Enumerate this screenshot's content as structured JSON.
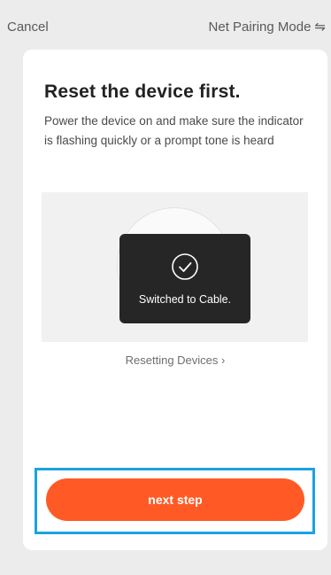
{
  "header": {
    "cancel_label": "Cancel",
    "mode_label": "Net Pairing Mode",
    "mode_icon": "⇋",
    "mode_icon_name": "swap-icon"
  },
  "card": {
    "title": "Reset the device first.",
    "description": "Power the device on and make sure the indicator is flashing quickly or a prompt tone is heard",
    "toast_text": "Switched to Cable.",
    "reset_link": "Resetting Devices ›",
    "next_label": "next step"
  },
  "colors": {
    "accent": "#ff5a25",
    "highlight": "#1aa3e2",
    "toast_bg": "#262626",
    "page_bg": "#ececec"
  }
}
